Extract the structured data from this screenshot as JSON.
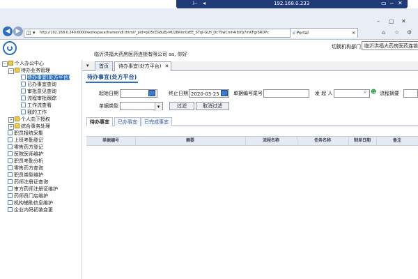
{
  "remote_session": {
    "ip": "192.168.0.233"
  },
  "browser": {
    "address": "http://192.168.0.240:6000/workspace/frameindl.thtml?_pid=pD5rZG8uEJ-MU2BRim0zEE_STqI-GLH_Dc75wCmh4ilbYp7mKFgrSRDPc",
    "tab_label": "Portal"
  },
  "header": {
    "switch_org_label": "切换机构部门",
    "org_select_value": "临沂洪福大药房医药连锁",
    "welcome": "临沂洪福大药房医药连锁有限公司 sa, 你好"
  },
  "tree": {
    "root": "个人办公中心",
    "business": "待办业务管理",
    "items": [
      "待办事宜(处方平台)",
      "已办事宜查询",
      "审批意见查询",
      "流程审批跟踪",
      "工作流查看",
      "我的工作"
    ],
    "personal": "个人向下授权",
    "affairs": "综合事务处理",
    "modules": [
      "职员报统采集",
      "上班考勤登记",
      "零售药方登记",
      "医院医师维护",
      "职员考勤分析",
      "零售药方查询",
      "职员类型维护",
      "药师注册证查询",
      "审方药师注册证维护",
      "药师员门店维护",
      "机构辅助信息维护",
      "企业内码初装变更"
    ]
  },
  "tabs": [
    {
      "label": "首页"
    },
    {
      "label": "待办事宜(处方平台)"
    }
  ],
  "section_title": "待办事宜(处方平台)",
  "filters": {
    "start_date_label": "起始日期",
    "start_date_value": "",
    "end_date_label": "终止日期",
    "end_date_value": "2020-03-25",
    "doc_no_label": "单据编号尾号",
    "initiator_label": "发 起 人",
    "flow_summary_label": "流程摘要",
    "doc_type_label": "单据类型",
    "filter_button": "过滤",
    "cancel_filter_button": "取消过滤"
  },
  "subtabs": [
    {
      "label": "待办事宜"
    },
    {
      "label": "已办事宜"
    },
    {
      "label": "已完成事宜"
    }
  ],
  "grid_columns": [
    "单据编号",
    "摘要",
    "流程名称",
    "任务名称",
    "制单日期",
    "备注"
  ],
  "colors": {
    "accent": "#2d6fc5",
    "title": "#1d4f9a"
  }
}
